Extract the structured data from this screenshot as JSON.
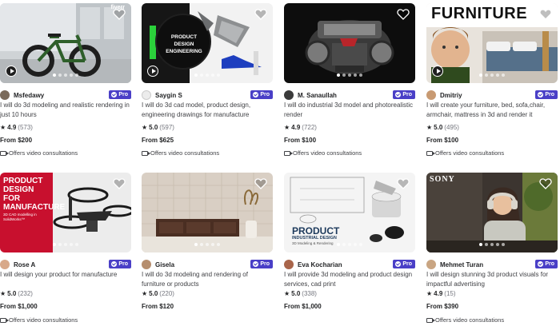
{
  "pro_label": "Pro",
  "pro_color": "#4a3fc7",
  "gigs": [
    {
      "seller": "Msfedawy",
      "title": "I will do 3d modeling and realistic rendering in just 10 hours",
      "score": "4.9",
      "count": "(573)",
      "price": "From $200",
      "offers": "Offers video consultations",
      "thumb_text": "fiverr",
      "has_play": true
    },
    {
      "seller": "Saygin S",
      "title": "I will do 3d cad model, product design, engineering drawings for manufacture",
      "score": "5.0",
      "count": "(597)",
      "price": "From $625",
      "offers": "Offers video consultations",
      "thumb_text": "PRODUCT DESIGN ENGINEERING",
      "has_play": true
    },
    {
      "seller": "M. Sanaullah",
      "title": "I will do industrial 3d model and photorealistic render",
      "score": "4.9",
      "count": "(722)",
      "price": "From $100",
      "offers": "Offers video consultations",
      "thumb_text": "",
      "has_play": false
    },
    {
      "seller": "Dmitriy",
      "title": "I will create your furniture, bed, sofa,chair, armchair, mattress in 3d and render it",
      "score": "5.0",
      "count": "(495)",
      "price": "From $100",
      "offers": "Offers video consultations",
      "thumb_text": "FURNITURE",
      "has_play": true
    },
    {
      "seller": "Rose A",
      "title": "I will design your product for manufacture",
      "score": "5.0",
      "count": "(232)",
      "price": "From $1,000",
      "offers": "Offers video consultations",
      "thumb_text": "PRODUCT DESIGN FOR MANUFACTURE",
      "thumb_sub": "3D CAD modelling in SolidWorks™",
      "has_play": false
    },
    {
      "seller": "Gisela",
      "title": "I will do 3d modeling and rendering of furniture or products",
      "score": "5.0",
      "count": "(220)",
      "price": "From $120",
      "offers": "",
      "thumb_text": "",
      "has_play": false
    },
    {
      "seller": "Eva Kocharian",
      "title": "I will provide 3d modeling and product design services, cad print",
      "score": "5.0",
      "count": "(338)",
      "price": "From $1,000",
      "offers": "",
      "thumb_text": "PRODUCT",
      "thumb_sub": "INDUSTRIAL DESIGN",
      "thumb_sub2": "3D Modeling & Rendering",
      "has_play": false
    },
    {
      "seller": "Mehmet Turan",
      "title": "I will design stunning 3d product visuals for impactful advertising",
      "score": "4.9",
      "count": "(15)",
      "price": "From $390",
      "offers": "Offers video consultations",
      "thumb_text": "SONY",
      "has_play": false
    }
  ]
}
